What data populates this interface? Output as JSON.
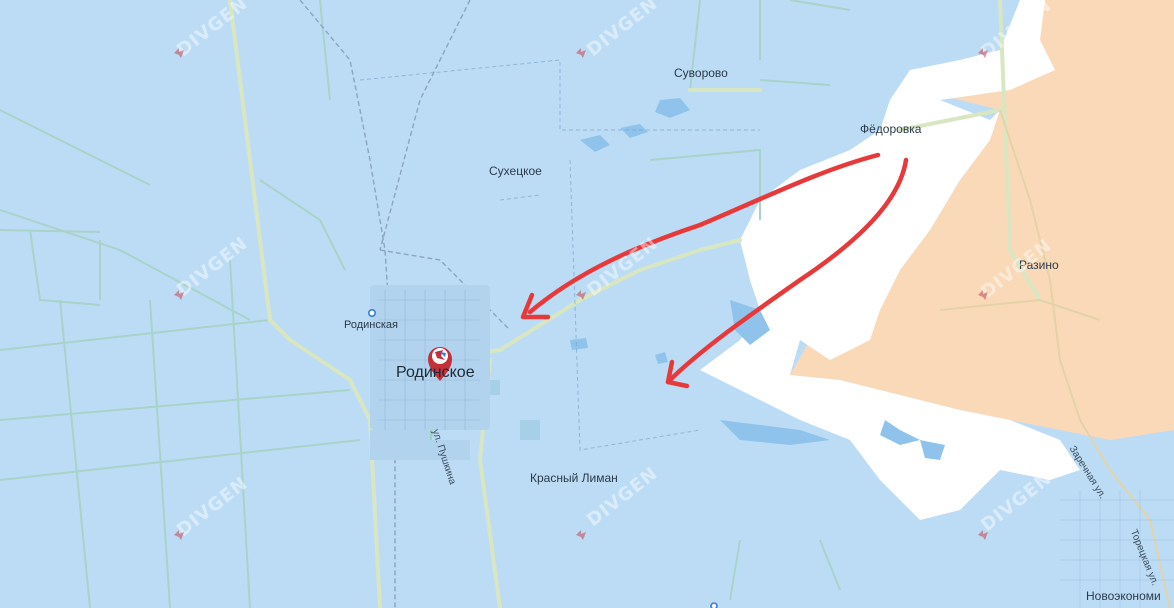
{
  "map": {
    "labels": {
      "suvorovo": "Суворово",
      "fedorovka": "Фёдоровка",
      "sukhetskoe": "Сухецкое",
      "razino": "Разино",
      "rodinskaya_station": "Родинская",
      "rodinskoe": "Родинское",
      "krasny_liman": "Красный Лиман",
      "novoekonomicheskoe": "Новоэкономи",
      "ul_pushkina": "ул. Пушкина",
      "zarechnaya": "Заречная ул.",
      "toretskaya": "Торецкая ул."
    },
    "watermark": "DIVGEN",
    "colors": {
      "base": "#bcdcf5",
      "controlled_zone": "#fad9b8",
      "gray_zone": "#ffffff",
      "water": "#8fc3ec",
      "field_lines": "#a8d3c8",
      "roads": "#d8e6c2",
      "arrow": "#e8393a",
      "marker": "#c4303a"
    }
  }
}
